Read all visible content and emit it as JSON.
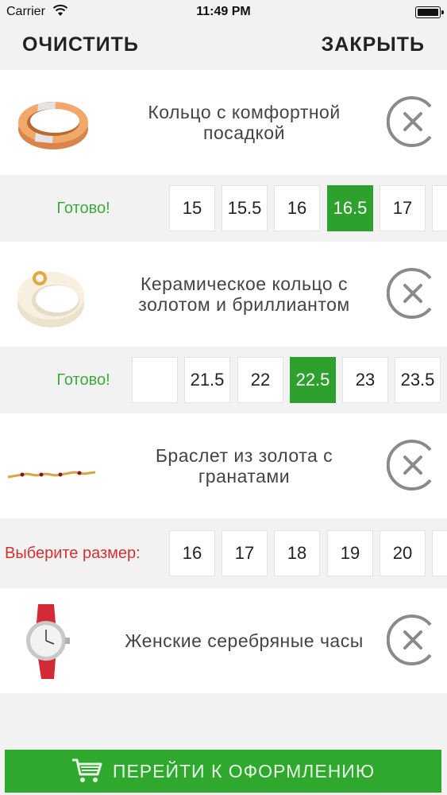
{
  "status": {
    "carrier": "Carrier",
    "time": "11:49 PM"
  },
  "topbar": {
    "clear_label": "ОЧИСТИТЬ",
    "close_label": "ЗАКРЫТЬ"
  },
  "items": [
    {
      "name": "Кольцо с комфортной посадкой",
      "image": "gold-ring-image",
      "size_label": "Готово!",
      "sizes": [
        "15",
        "15.5",
        "16",
        "16.5",
        "17",
        "1"
      ],
      "selected": "16.5"
    },
    {
      "name": "Керамическое кольцо с золотом и бриллиантом",
      "image": "ceramic-ring-image",
      "size_label": "Готово!",
      "sizes": [
        "",
        "21.5",
        "22",
        "22.5",
        "23",
        "23.5"
      ],
      "selected": "22.5"
    },
    {
      "name": "Браслет из золота с гранатами",
      "image": "bracelet-image",
      "size_label": "Выберите размер:",
      "sizes": [
        "16",
        "17",
        "18",
        "19",
        "20",
        ""
      ],
      "selected": ""
    },
    {
      "name": "Женские серебряные часы",
      "image": "watch-image"
    }
  ],
  "checkout": {
    "label": "ПЕРЕЙТИ К ОФОРМЛЕНИЮ",
    "icon": "cart-icon"
  },
  "colors": {
    "accent_green": "#2ea92e",
    "ok_text": "#3faa3f",
    "warn_text": "#d03232"
  }
}
